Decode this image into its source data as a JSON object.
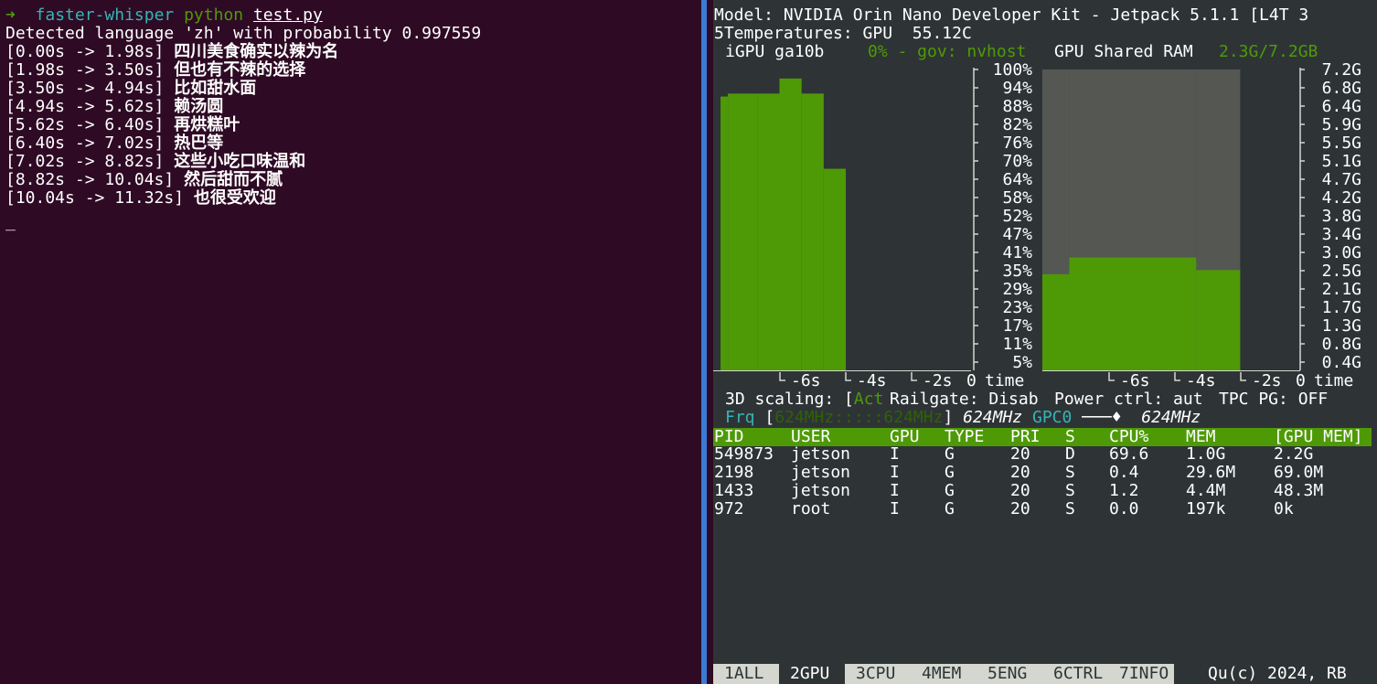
{
  "left_terminal": {
    "prompt_arrow": "➜",
    "prompt_dir": "faster-whisper",
    "prompt_cmd": "python",
    "prompt_file": "test.py",
    "detected": "Detected language 'zh' with probability 0.997559",
    "lines": [
      {
        "ts": "[0.00s -> 1.98s]",
        "text": "四川美食确实以辣为名"
      },
      {
        "ts": "[1.98s -> 3.50s]",
        "text": "但也有不辣的选择"
      },
      {
        "ts": "[3.50s -> 4.94s]",
        "text": "比如甜水面"
      },
      {
        "ts": "[4.94s -> 5.62s]",
        "text": "赖汤圆"
      },
      {
        "ts": "[5.62s -> 6.40s]",
        "text": "再烘糕叶"
      },
      {
        "ts": "[6.40s -> 7.02s]",
        "text": "热巴等"
      },
      {
        "ts": "[7.02s -> 8.82s]",
        "text": "这些小吃口味温和"
      },
      {
        "ts": "[8.82s -> 10.04s]",
        "text": "然后甜而不腻"
      },
      {
        "ts": "[10.04s -> 11.32s]",
        "text": "也很受欢迎"
      }
    ],
    "cursor": "_"
  },
  "jtop": {
    "model_line": "Model: NVIDIA Orin Nano Developer Kit - Jetpack 5.1.1 [L4T 3",
    "temp_prefix": "5Temperatures: GPU",
    "temp_value": "55.12C",
    "gpu_name": "iGPU ga10b",
    "gpu_load": "0% - gov: nvhost",
    "shared_ram_label": "GPU Shared RAM",
    "shared_ram_value": "2.3G/7.2GB",
    "colors": {
      "green": "#4e9a06",
      "gray": "#555753",
      "cyan": "#34b5b5",
      "background": "#2e3436"
    },
    "gpu_chart": {
      "y_ticks": [
        "100%",
        "94%",
        "88%",
        "82%",
        "76%",
        "70%",
        "64%",
        "58%",
        "52%",
        "47%",
        "41%",
        "35%",
        "29%",
        "23%",
        "17%",
        "11%",
        "5%"
      ],
      "x_ticks": [
        "-6s",
        "-4s",
        "-2s",
        "0"
      ],
      "x_label": "time"
    },
    "ram_chart": {
      "y_ticks": [
        "7.2G",
        "6.8G",
        "6.4G",
        "5.9G",
        "5.5G",
        "5.1G",
        "4.7G",
        "4.2G",
        "3.8G",
        "3.4G",
        "3.0G",
        "2.5G",
        "2.1G",
        "1.7G",
        "1.3G",
        "0.8G",
        "0.4G"
      ],
      "x_ticks": [
        "-6s",
        "-4s",
        "-2s",
        "0"
      ],
      "x_label": "time"
    },
    "chart_data": [
      {
        "type": "area",
        "x": [
          -6.8,
          -6.6,
          -5.8,
          -5.2,
          -4.6,
          -4.0,
          -3.4
        ],
        "values": [
          91,
          92,
          92,
          97,
          92,
          67,
          0
        ],
        "ylim": [
          0,
          100
        ],
        "xlim": [
          -7,
          0
        ]
      },
      {
        "type": "area",
        "series": [
          {
            "values": [
              7.2,
              7.2,
              7.2
            ]
          },
          {
            "values": [
              2.3,
              2.7,
              2.4
            ]
          }
        ],
        "x": [
          -5.6,
          -4.0,
          -1.8
        ],
        "ylim": [
          0,
          7.2
        ],
        "xlim": [
          -7,
          0
        ]
      }
    ],
    "scaling_label": "3D scaling: [",
    "scaling_value": "Act",
    "railgate": "Railgate: Disab",
    "power_ctrl": "Power ctrl: aut",
    "tpc_pg": "TPC PG: OFF",
    "frq_label": "Frq",
    "frq_bracket_open": "[",
    "frq_range": "624MHz:::::624MHz",
    "frq_bracket_close": "]",
    "frq_value": "624MHz",
    "gpc_label": "GPC0",
    "gpc_slider": "───♦",
    "gpc_value": "624MHz",
    "table": {
      "headers": [
        "PID",
        "USER",
        "GPU",
        "TYPE",
        "PRI",
        "S",
        "CPU%",
        "MEM",
        "[GPU MEM]"
      ],
      "rows": [
        [
          "549873",
          "jetson",
          "I",
          "G",
          "20",
          "D",
          "69.6",
          "1.0G",
          "2.2G"
        ],
        [
          "2198",
          "jetson",
          "I",
          "G",
          "20",
          "S",
          "0.4",
          "29.6M",
          "69.0M"
        ],
        [
          "1433",
          "jetson",
          "I",
          "G",
          "20",
          "S",
          "1.2",
          "4.4M",
          "48.3M"
        ],
        [
          "972",
          "root",
          "I",
          "G",
          "20",
          "S",
          "0.0",
          "197k",
          "0k"
        ]
      ]
    },
    "tabs": [
      {
        "num": "1",
        "label": "ALL"
      },
      {
        "num": "2",
        "label": "GPU"
      },
      {
        "num": "3",
        "label": "CPU"
      },
      {
        "num": "4",
        "label": "MEM"
      },
      {
        "num": "5",
        "label": "ENG"
      },
      {
        "num": "6",
        "label": "CTRL"
      },
      {
        "num": "7",
        "label": "INFO"
      }
    ],
    "active_tab": "2",
    "quit_copyright": "Qu(c) 2024, RB"
  }
}
